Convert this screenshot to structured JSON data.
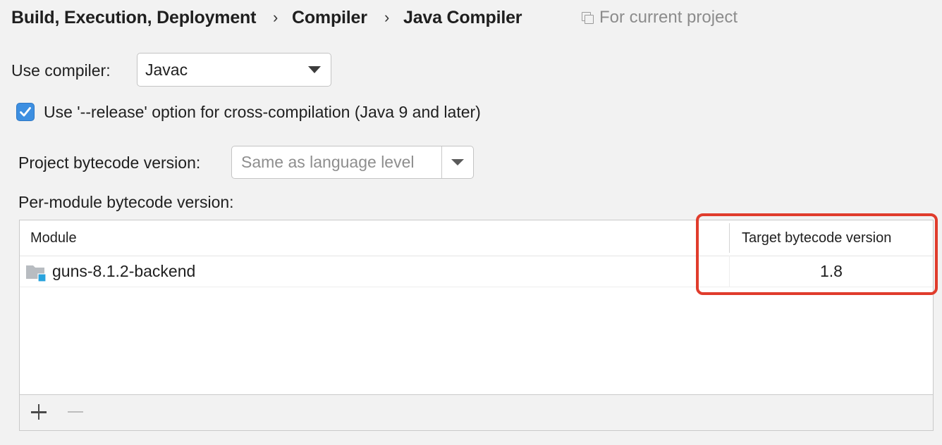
{
  "breadcrumb": {
    "items": [
      "Build, Execution, Deployment",
      "Compiler",
      "Java Compiler"
    ],
    "separator": "›",
    "scope_label": "For current project"
  },
  "compiler": {
    "label": "Use compiler:",
    "value": "Javac"
  },
  "release_option": {
    "label": "Use '--release' option for cross-compilation (Java 9 and later)",
    "checked": true
  },
  "project_bytecode": {
    "label": "Project bytecode version:",
    "placeholder": "Same as language level"
  },
  "per_module": {
    "label": "Per-module bytecode version:",
    "columns": [
      "Module",
      "Target bytecode version"
    ],
    "rows": [
      {
        "module": "guns-8.1.2-backend",
        "target": "1.8"
      }
    ]
  },
  "toolbar": {
    "add_icon": "plus-icon",
    "remove_icon": "minus-icon"
  },
  "colors": {
    "accent": "#3d8fe1",
    "highlight": "#e03c2c",
    "module_icon": "#29a3dd"
  }
}
